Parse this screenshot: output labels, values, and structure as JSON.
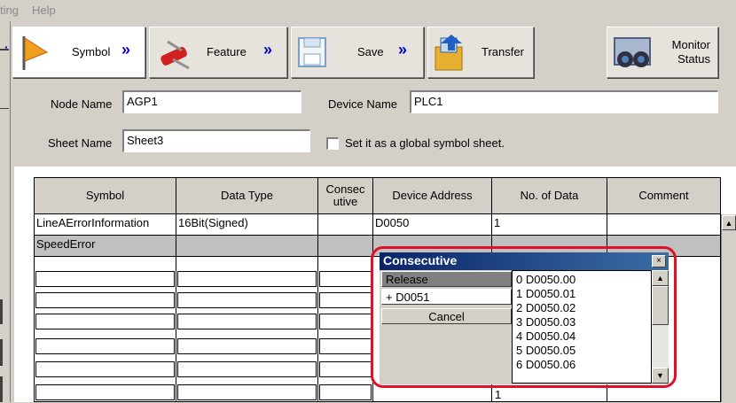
{
  "menu": {
    "items": [
      "ting",
      "Help"
    ]
  },
  "toolbar": {
    "symbol": "Symbol",
    "feature": "Feature",
    "save": "Save",
    "transfer": "Transfer",
    "monitor_line1": "Monitor",
    "monitor_line2": "Status",
    "arrow": "»"
  },
  "form": {
    "node_name_label": "Node Name",
    "node_name_value": "AGP1",
    "device_name_label": "Device Name",
    "device_name_value": "PLC1",
    "sheet_name_label": "Sheet Name",
    "sheet_name_value": "Sheet3",
    "global_checkbox_label": "Set it as a global symbol sheet.",
    "global_checked": false
  },
  "grid": {
    "columns": [
      "Symbol",
      "Data Type",
      "Consec utive",
      "Device Address",
      "No. of Data",
      "Comment"
    ],
    "consec_line1": "Consec",
    "consec_line2": "utive",
    "rows": [
      {
        "symbol": "LineAErrorInformation",
        "data_type": "16Bit(Signed)",
        "consecutive": "",
        "device_address": "D0050",
        "no_of_data": "1",
        "comment": ""
      },
      {
        "symbol": "SpeedError",
        "data_type": "",
        "consecutive": "",
        "device_address": "",
        "no_of_data": "",
        "comment": ""
      }
    ],
    "partial_no_of_data": [
      "1",
      "1",
      "1"
    ]
  },
  "popup": {
    "title": "Consecutive",
    "close": "×",
    "release": "Release",
    "expand": "+  D0051",
    "cancel": "Cancel",
    "list": [
      "0  D0050.00",
      "1  D0050.01",
      "2  D0050.02",
      "3  D0050.03",
      "4  D0050.04",
      "5  D0050.05",
      "6  D0050.06"
    ]
  },
  "colors": {
    "highlight_border": "#e0102a",
    "title_bar": "#0a246a",
    "arrow": "#0000cc"
  }
}
